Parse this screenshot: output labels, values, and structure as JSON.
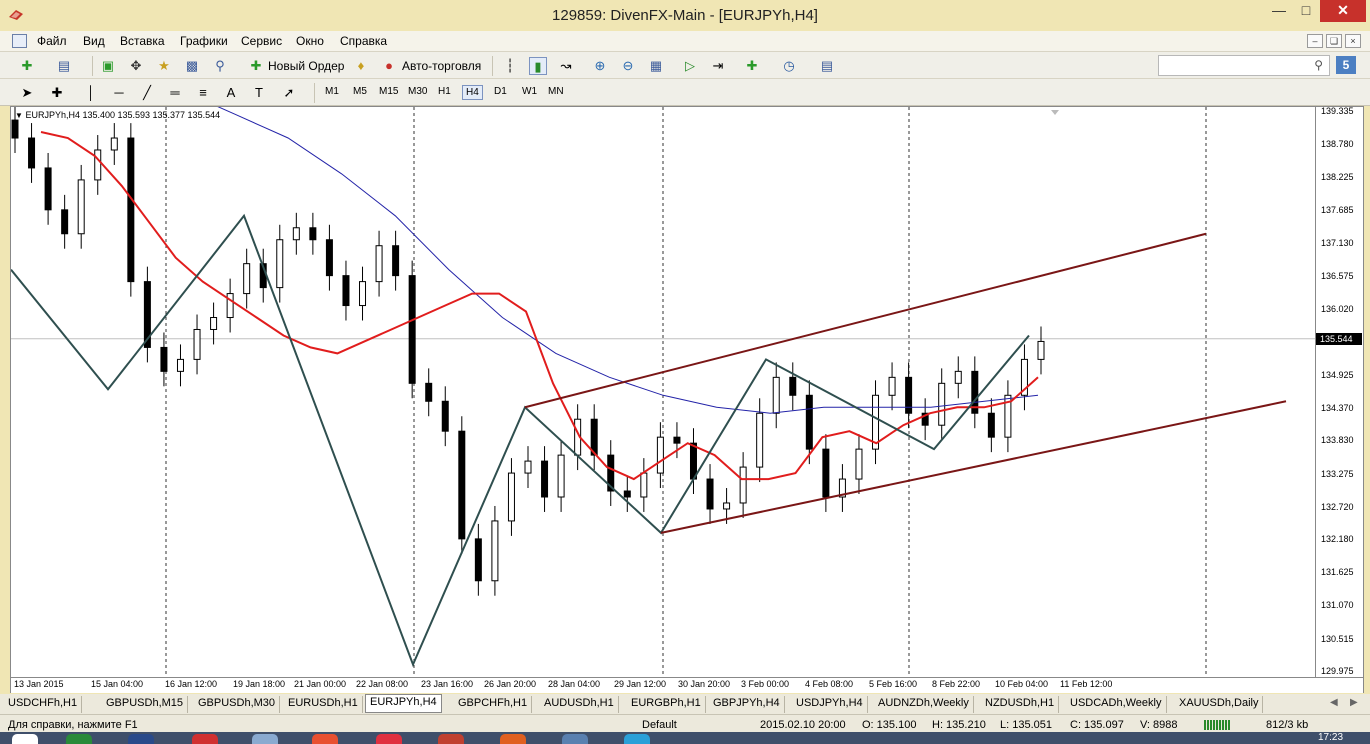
{
  "window": {
    "title": "129859: DivenFX-Main - [EURJPYh,H4]"
  },
  "menu": {
    "items": [
      "Файл",
      "Вид",
      "Вставка",
      "Графики",
      "Сервис",
      "Окно",
      "Справка"
    ]
  },
  "toolbar": {
    "new_order_label": "Новый Ордер",
    "auto_trading_label": "Авто-торговля",
    "help_badge": "5",
    "search_value": ""
  },
  "timeframes": [
    "M1",
    "M5",
    "M15",
    "M30",
    "H1",
    "H4",
    "D1",
    "W1",
    "MN"
  ],
  "active_timeframe": "H4",
  "chart": {
    "header": "EURJPYh,H4  135.400 135.593 135.377 135.544",
    "current_price": "135.544"
  },
  "chart_data": {
    "type": "candlestick",
    "symbol": "EURJPYh",
    "timeframe": "H4",
    "ohlc_header": {
      "open": 135.4,
      "high": 135.593,
      "low": 135.377,
      "close": 135.544
    },
    "ylim": [
      129.975,
      139.335
    ],
    "price_ticks": [
      "139.335",
      "138.780",
      "138.225",
      "137.685",
      "137.130",
      "136.575",
      "136.020",
      "135.544",
      "134.925",
      "134.370",
      "133.830",
      "133.275",
      "132.720",
      "132.180",
      "131.625",
      "131.070",
      "130.515",
      "129.975"
    ],
    "time_ticks": [
      "13 Jan 2015",
      "15 Jan 04:00",
      "16 Jan 12:00",
      "19 Jan 18:00",
      "21 Jan 00:00",
      "22 Jan 08:00",
      "23 Jan 16:00",
      "26 Jan 20:00",
      "28 Jan 04:00",
      "29 Jan 12:00",
      "30 Jan 20:00",
      "3 Feb 00:00",
      "4 Feb 08:00",
      "5 Feb 16:00",
      "8 Feb 22:00",
      "10 Feb 04:00",
      "11 Feb 12:00"
    ],
    "candles_close": [
      138.9,
      138.4,
      137.7,
      137.3,
      138.2,
      138.7,
      138.9,
      136.5,
      135.4,
      135.0,
      135.2,
      135.7,
      135.9,
      136.3,
      136.8,
      136.4,
      137.2,
      137.4,
      137.2,
      136.6,
      136.1,
      136.5,
      137.1,
      136.6,
      134.8,
      134.5,
      134.0,
      132.2,
      131.5,
      132.5,
      133.3,
      133.5,
      132.9,
      133.6,
      134.2,
      133.6,
      133.0,
      132.9,
      133.3,
      133.9,
      133.8,
      133.2,
      132.7,
      132.8,
      133.4,
      134.3,
      134.9,
      134.6,
      133.7,
      132.9,
      133.2,
      133.7,
      134.6,
      134.9,
      134.3,
      134.1,
      134.8,
      135.0,
      134.3,
      133.9,
      134.6,
      135.2,
      135.5
    ],
    "ma_red": [
      139.0,
      138.9,
      138.6,
      138.1,
      137.5,
      136.9,
      136.5,
      136.2,
      135.9,
      135.6,
      135.4,
      135.3,
      135.5,
      135.7,
      135.9,
      136.1,
      136.3,
      136.3,
      136.0,
      134.8,
      133.9,
      133.4,
      133.2,
      133.5,
      133.8,
      133.6,
      133.2,
      133.2,
      133.3,
      133.9,
      134.0,
      133.8,
      134.1,
      134.3,
      134.4,
      134.4,
      134.5,
      134.9
    ],
    "ma_blue": [
      139.7,
      139.3,
      138.9,
      138.3,
      137.6,
      136.7,
      135.9,
      135.3,
      134.9,
      134.6,
      134.4,
      134.3,
      134.4,
      134.4,
      134.4,
      134.5,
      134.6
    ],
    "zigzag": [
      {
        "x": "13 Jan 2015",
        "y": 136.7
      },
      {
        "x": "15 Jan 04:00",
        "y": 134.7
      },
      {
        "x": "19 Jan 18:00",
        "y": 137.6
      },
      {
        "x": "23 Jan 16:00",
        "y": 130.1
      },
      {
        "x": "28 Jan 04:00",
        "y": 134.4
      },
      {
        "x": "30 Jan 20:00",
        "y": 132.3
      },
      {
        "x": "3 Feb 00:00",
        "y": 135.2
      },
      {
        "x": "8 Feb 22:00",
        "y": 133.7
      },
      {
        "x": "10 Feb 04:00",
        "y": 135.6
      }
    ],
    "channel": {
      "upper": [
        {
          "x": "28 Jan 04:00",
          "y": 134.4
        },
        {
          "x": "11 Feb 12:00",
          "y": 137.3
        }
      ],
      "lower": [
        {
          "x": "30 Jan 20:00",
          "y": 132.3
        },
        {
          "x": "11 Feb 12:00",
          "y": 134.5
        }
      ]
    },
    "grid": false
  },
  "tabs": [
    "USDCHFh,H1",
    "GBPUSDh,M15",
    "GBPUSDh,M30",
    "EURUSDh,H1",
    "EURJPYh,H4",
    "GBPCHFh,H1",
    "AUDUSDh,H1",
    "EURGBPh,H1",
    "GBPJPYh,H4",
    "USDJPYh,H4",
    "AUDNZDh,Weekly",
    "NZDUSDh,H1",
    "USDCADh,Weekly",
    "XAUUSDh,Daily"
  ],
  "active_tab": "EURJPYh,H4",
  "status": {
    "help": "Для справки, нажмите F1",
    "profile": "Default",
    "datetime": "2015.02.10 20:00",
    "open": "O: 135.100",
    "high": "H: 135.210",
    "low": "L: 135.051",
    "close": "C: 135.097",
    "volume": "V: 8988",
    "traffic": "812/3 kb"
  },
  "taskbar": {
    "clock": "17:23"
  },
  "colors": {
    "ma_red": "#e11d1d",
    "ma_blue": "#2323a8",
    "zigzag": "#2f4f4f",
    "channel": "#7a1616",
    "candle": "#000000"
  }
}
